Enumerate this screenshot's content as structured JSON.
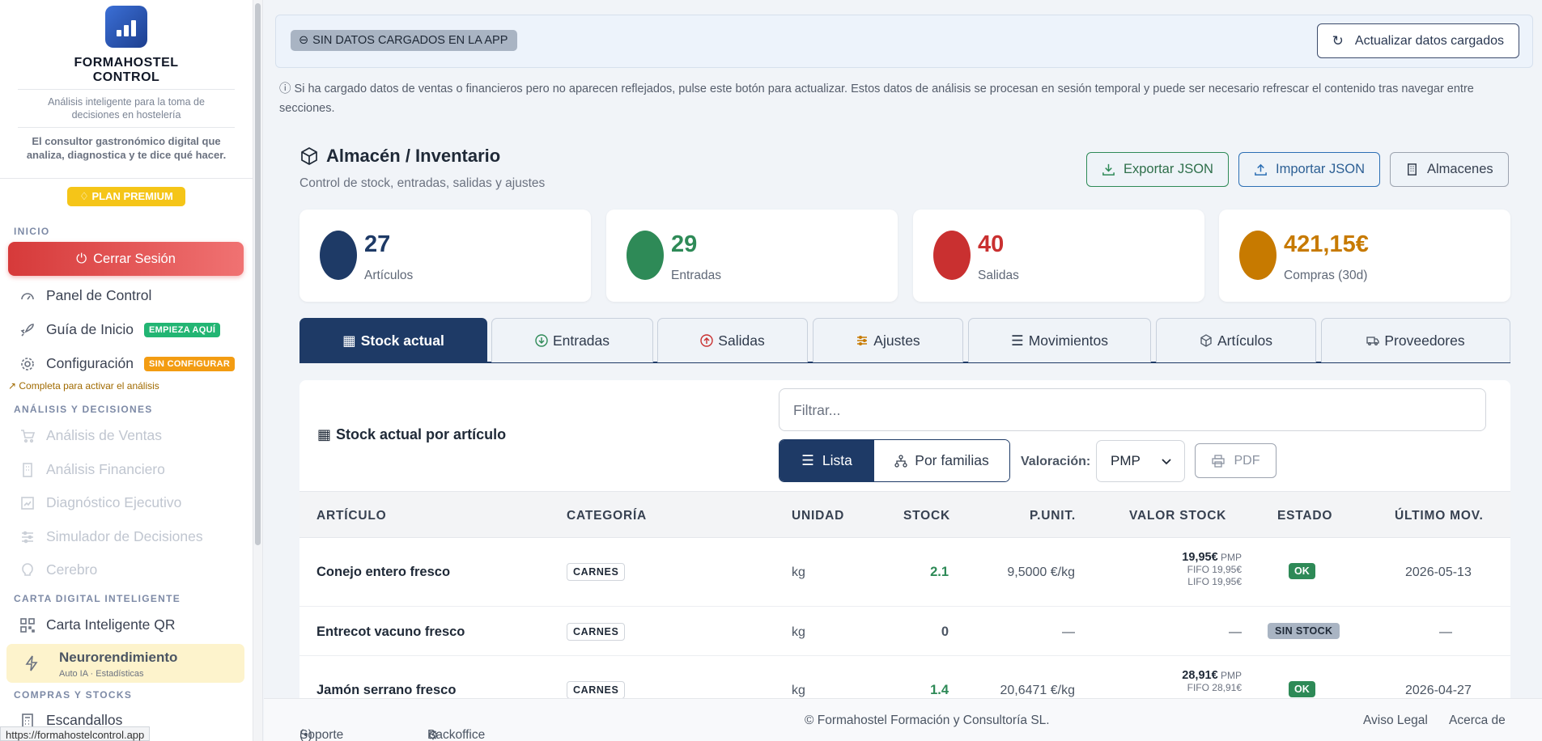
{
  "brand": {
    "name_line1": "FORMAHOSTEL",
    "name_line2": "CONTROL",
    "subtitle": "Análisis inteligente para la toma de decisiones en hostelería",
    "quote": "El consultor gastronómico digital que analiza, diagnostica y te dice qué hacer.",
    "plan": "PLAN PREMIUM"
  },
  "sidebar": {
    "section_inicio": "INICIO",
    "logout": "Cerrar Sesión",
    "panel": "Panel de Control",
    "guia": "Guía de Inicio",
    "guia_badge": "EMPIEZA AQUÍ",
    "config": "Configuración",
    "config_badge": "SIN CONFIGURAR",
    "config_hint": "Completa para activar el análisis",
    "section_analisis": "ANÁLISIS Y DECISIONES",
    "ventas": "Análisis de Ventas",
    "financiero": "Análisis Financiero",
    "diagnostico": "Diagnóstico Ejecutivo",
    "simulador": "Simulador de Decisiones",
    "cerebro": "Cerebro",
    "section_carta": "CARTA DIGITAL INTELIGENTE",
    "carta_qr": "Carta Inteligente QR",
    "neuro": "Neurorendimiento",
    "neuro_sub": "Auto IA · Estadísticas",
    "section_compras": "COMPRAS Y STOCKS",
    "escandallos": "Escandallos",
    "status_url": "https://formahostelcontrol.app"
  },
  "topbar": {
    "nodata": "SIN DATOS CARGADOS EN LA APP",
    "refresh": "Actualizar datos cargados",
    "info": "ⓘ Si ha cargado datos de ventas o financieros pero no aparecen reflejados, pulse este botón para actualizar. Estos datos de análisis se procesan en sesión temporal y puede ser necesario refrescar el contenido tras navegar entre secciones."
  },
  "page": {
    "title": "Almacén / Inventario",
    "subtitle": "Control de stock, entradas, salidas y ajustes",
    "export": "Exportar JSON",
    "import": "Importar JSON",
    "almacenes": "Almacenes"
  },
  "stats": [
    {
      "value": "27",
      "label": "Artículos",
      "color": "#1e3a66"
    },
    {
      "value": "29",
      "label": "Entradas",
      "color": "#2e8a57"
    },
    {
      "value": "40",
      "label": "Salidas",
      "color": "#c93030"
    },
    {
      "value": "421,15€",
      "label": "Compras (30d)",
      "color": "#c77a00"
    }
  ],
  "tabs": [
    "Stock actual",
    "Entradas",
    "Salidas",
    "Ajustes",
    "Movimientos",
    "Artículos",
    "Proveedores"
  ],
  "panel": {
    "title": "Stock actual por artículo",
    "filter_placeholder": "Filtrar...",
    "view_list": "Lista",
    "view_families": "Por familias",
    "valuation_label": "Valoración:",
    "valuation": "PMP",
    "pdf": "PDF"
  },
  "table": {
    "headers": [
      "ARTÍCULO",
      "CATEGORÍA",
      "UNIDAD",
      "STOCK",
      "P.UNIT.",
      "VALOR STOCK",
      "ESTADO",
      "ÚLTIMO MOV."
    ],
    "rows": [
      {
        "name": "Conejo entero fresco",
        "category": "CARNES",
        "unit": "kg",
        "stock": "2.1",
        "price": "9,5000 €/kg",
        "value": "19,95€",
        "value_tag": "PMP",
        "fifo": "FIFO 19,95€",
        "lifo": "LIFO 19,95€",
        "status": "OK",
        "last": "2026-05-13"
      },
      {
        "name": "Entrecot vacuno fresco",
        "category": "CARNES",
        "unit": "kg",
        "stock": "0",
        "price": "—",
        "value": "—",
        "value_tag": "",
        "fifo": "",
        "lifo": "",
        "status": "SIN STOCK",
        "last": "—"
      },
      {
        "name": "Jamón serrano fresco",
        "category": "CARNES",
        "unit": "kg",
        "stock": "1.4",
        "price": "20,6471 €/kg",
        "value": "28,91€",
        "value_tag": "PMP",
        "fifo": "FIFO 28,91€",
        "lifo": "",
        "status": "OK",
        "last": "2026-04-27"
      }
    ]
  },
  "footer": {
    "soporte": "Soporte remoto",
    "backoffice": "Backoffice",
    "copyright": "© Formahostel Formación y Consultoría SL.",
    "aviso": "Aviso Legal",
    "acerca": "Acerca de"
  }
}
